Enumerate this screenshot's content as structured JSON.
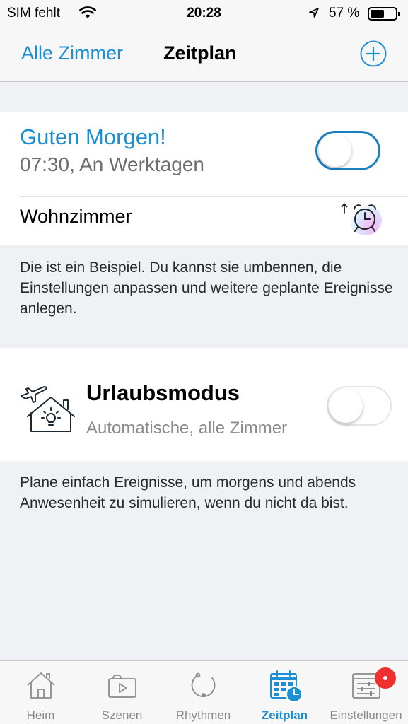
{
  "status": {
    "carrier": "SIM fehlt",
    "time": "20:28",
    "battery": "57 %",
    "battery_level": 0.57
  },
  "nav": {
    "back_label": "Alle Zimmer",
    "title": "Zeitplan",
    "add_icon": "plus-circle-icon",
    "accent": "#1c8fd3"
  },
  "schedule": {
    "title": "Guten Morgen!",
    "subtitle": "07:30, An Werktagen",
    "room": "Wohnzimmer",
    "enabled": false,
    "icon": "alarm-clock-icon",
    "description": "Die ist ein Beispiel. Du kannst sie umbennen, die Einstellungen anpassen und weitere geplante Ereignisse anlegen."
  },
  "vacation": {
    "title": "Urlaubsmodus",
    "subtitle": "Automatische, alle Zimmer",
    "enabled": false,
    "icon": "vacation-house-icon",
    "description": "Plane einfach Ereignisse, um morgens und abends Anwesenheit zu simulieren, wenn du nicht da bist."
  },
  "tabs": [
    {
      "label": "Heim",
      "icon": "home-icon",
      "active": false
    },
    {
      "label": "Szenen",
      "icon": "scenes-icon",
      "active": false
    },
    {
      "label": "Rhythmen",
      "icon": "rhythm-icon",
      "active": false
    },
    {
      "label": "Zeitplan",
      "icon": "calendar-clock-icon",
      "active": true
    },
    {
      "label": "Einstellungen",
      "icon": "settings-sliders-icon",
      "active": false,
      "badge": true
    }
  ],
  "colors": {
    "accent": "#1c8fd3",
    "badge": "#f0302e",
    "background": "#eff1f4"
  }
}
